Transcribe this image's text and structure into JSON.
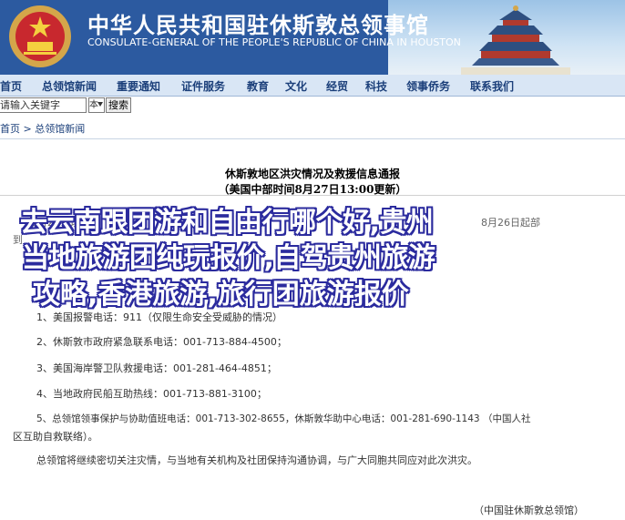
{
  "header": {
    "title_cn": "中华人民共和国驻休斯敦总领事馆",
    "title_en": "CONSULATE-GENERAL OF THE PEOPLE'S REPUBLIC OF CHINA IN HOUSTON"
  },
  "nav": {
    "items": [
      "首页",
      "总领馆新闻",
      "重要通知",
      "证件服务",
      "教育",
      "文化",
      "经贸",
      "科技",
      "领事侨务",
      "联系我们"
    ]
  },
  "search": {
    "input_value": "请输入关键字",
    "select_value": "本",
    "button_label": "搜索"
  },
  "breadcrumb": {
    "home": "首页",
    "sep": ">",
    "section": "总领馆新闻"
  },
  "article": {
    "title": "休斯敦地区洪灾情况及救援信息通报",
    "subtitle": "（美国中部时间8月27日13:00更新）",
    "intro_fragments": [
      "8月25日以来",
      "8月26日起部",
      "到"
    ],
    "list": [
      "1、美国报警电话：911（仅限生命安全受威胁的情况）",
      "2、休斯敦市政府紧急联系电话：001-713-884-4500；",
      "3、美国海岸警卫队救援电话：001-281-464-4851；",
      "4、当地政府民船互助热线：001-713-881-3100；",
      "5、总领馆领事保护与协助值班电话：001-713-302-8655，休斯敦华助中心电话：001-281-690-1143 （中国人社",
      "区互助自救联络）。"
    ],
    "closing": "总领馆将继续密切关注灾情，与当地有关机构及社团保持沟通协调，与广大同胞共同应对此次洪灾。",
    "signature": "（中国驻休斯敦总领馆）"
  },
  "overlay": {
    "line1": "去云南跟团游和自由行哪个好,贵州",
    "line2": "当地旅游团纯玩报价,自驾贵州旅游",
    "line3": "攻略,香港旅游,旅行团旅游报价"
  },
  "colors": {
    "header_bg": "#2c5aa0",
    "nav_bg": "#d9e6f5",
    "overlay_text": "#ffffff",
    "overlay_stroke": "#2b2b9e"
  }
}
